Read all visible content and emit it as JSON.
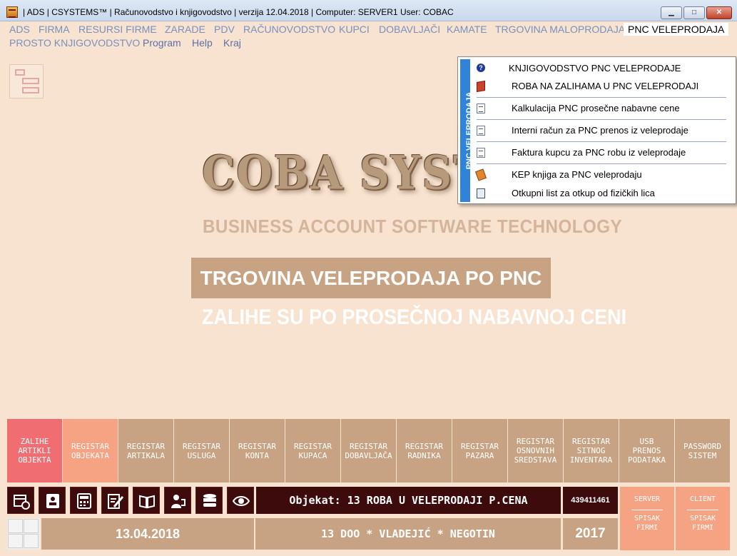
{
  "window": {
    "title": "| ADS | CSYSTEMS™ | Računovodstvo i knjigovodstvo |   verzija 12.04.2018   |  Computer: SERVER1  User: COBAC",
    "min": "▁",
    "max": "□",
    "close": "✕"
  },
  "menu": {
    "row1": [
      "ADS",
      "FIRMA",
      "RESURSI FIRME",
      "ZARADE",
      "PDV",
      "RAČUNOVODSTVO",
      "KUPCI",
      "DOBAVLJAČI",
      "KAMATE",
      "TRGOVINA MALOPRODAJA",
      "PNC VELEPRODAJA"
    ],
    "row2": [
      "PROSTO KNJIGOVODSTVO",
      "Program",
      "Help",
      "Kraj"
    ]
  },
  "dropdown": {
    "band_label": "PNC VELEPRODAJA",
    "items": [
      {
        "label": "KNJIGOVODSTVO PNC VELEPRODAJE",
        "icon": "help-icon"
      },
      {
        "label": "ROBA NA ZALIHAMA U PNC VELEPRODAJI",
        "icon": "box-icon"
      },
      {
        "label": "Kalkulacija PNC prosečne nabavne cene",
        "icon": "document-icon"
      },
      {
        "label": "Interni račun za PNC prenos iz veleprodaje",
        "icon": "document-icon"
      },
      {
        "label": "Faktura kupcu za PNC robu iz veleprodaje",
        "icon": "document-icon"
      },
      {
        "label": "KEP knjiga za PNC veleprodaju",
        "icon": "book-icon"
      },
      {
        "label": "Otkupni list za otkup od fizičkih lica",
        "icon": "calculator-icon"
      }
    ]
  },
  "branding": {
    "logo": "COBA SYSTEMS",
    "subtitle": "BUSINESS ACCOUNT SOFTWARE TECHNOLOGY",
    "module_title": "TRGOVINA VELEPRODAJA PO PNC",
    "module_subtitle": "ZALIHE SU PO PROSEČNOJ NABAVNOJ CENI"
  },
  "registers": [
    {
      "label": "ZALIHE\nARTIKLI\nOBJEKTA",
      "color": "#f06e71"
    },
    {
      "label": "REGISTAR\nOBJEKATA",
      "color": "#f5a383"
    },
    {
      "label": "REGISTAR\nARTIKALA",
      "color": "#c8a383"
    },
    {
      "label": "REGISTAR\nUSLUGA",
      "color": "#c8a383"
    },
    {
      "label": "REGISTAR\nKONTA",
      "color": "#c8a383"
    },
    {
      "label": "REGISTAR\nKUPACA",
      "color": "#c8a383"
    },
    {
      "label": "REGISTAR\nDOBAVLJAČA",
      "color": "#c8a383"
    },
    {
      "label": "REGISTAR\nRADNIKA",
      "color": "#c8a383"
    },
    {
      "label": "REGISTAR\nPAZARA",
      "color": "#c8a383"
    },
    {
      "label": "REGISTAR\nOSNOVNIH\nSREDSTAVA",
      "color": "#c8a383"
    },
    {
      "label": "REGISTAR\nSITNOG\nINVENTARA",
      "color": "#c8a383"
    },
    {
      "label": "USB\nPRENOS\nPODATAKA",
      "color": "#c8a383"
    },
    {
      "label": "PASSWORD\nSISTEM",
      "color": "#c8a383"
    }
  ],
  "toolbar_icons": [
    "calendar-clock-icon",
    "contact-card-icon",
    "calculator-icon",
    "edit-document-icon",
    "open-book-icon",
    "phone-user-icon",
    "database-icon",
    "eye-icon"
  ],
  "status": {
    "object_label": "Objekat: 13  ROBA U VELEPRODAJI P.CENA",
    "object_code": "439411461",
    "date": "13.04.2018",
    "firm": "13  DOO * VLADEJIĆ * NEGOTIN",
    "year": "2017"
  },
  "side_buttons": {
    "server": {
      "top": "SERVER",
      "bottom": "SPISAK\nFIRMI"
    },
    "client": {
      "top": "CLIENT",
      "bottom": "SPISAK\nFIRMI"
    }
  }
}
